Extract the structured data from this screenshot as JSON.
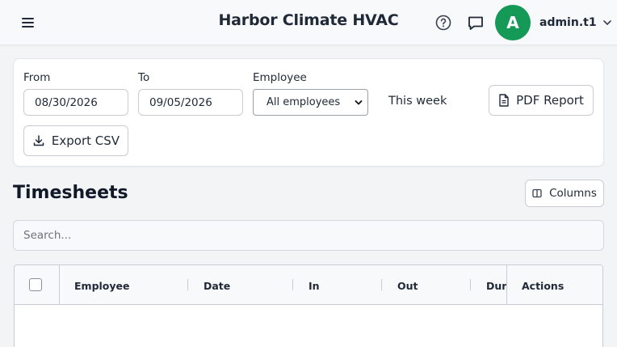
{
  "header": {
    "title": "Harbor Climate HVAC",
    "avatar_initial": "A",
    "username": "admin.t1"
  },
  "filters": {
    "from_label": "From",
    "from_value": "08/30/2026",
    "to_label": "To",
    "to_value": "09/05/2026",
    "employee_label": "Employee",
    "employee_selected": "All employees",
    "range_label": "This week",
    "pdf_button": "PDF Report",
    "csv_button": "Export CSV"
  },
  "timesheets": {
    "title": "Timesheets",
    "columns_button": "Columns",
    "search_placeholder": "Search...",
    "columns": [
      "Employee",
      "Date",
      "In",
      "Out",
      "Duration"
    ],
    "actions_header": "Actions"
  },
  "colors": {
    "avatar_bg": "#159957",
    "page_bg": "#f3f4f6"
  }
}
